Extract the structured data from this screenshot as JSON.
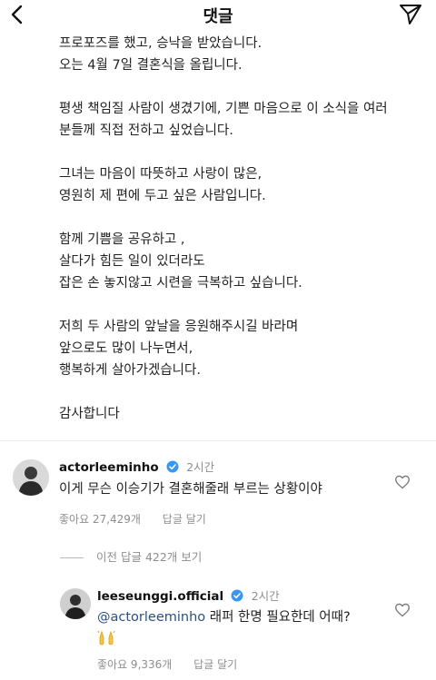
{
  "header": {
    "title": "댓글"
  },
  "post": {
    "lines": [
      "프로포즈를 했고, 승낙을 받았습니다.",
      "오는 4월 7일 결혼식을 올립니다.",
      "",
      "평생 책임질 사람이 생겼기에, 기쁜 마음으로 이 소식을 여러",
      "분들께 직접 전하고 싶었습니다.",
      "",
      "그녀는 마음이 따뜻하고 사랑이 많은,",
      "영원히 제 편에 두고 싶은 사람입니다.",
      "",
      "함께 기쁨을 공유하고 ,",
      "살다가 힘든 일이 있더라도",
      "잡은 손 놓지않고 시련을 극복하고 싶습니다.",
      "",
      "저희 두 사람의 앞날을 응원해주시길 바라며",
      "앞으로도 많이 나누면서,",
      "행복하게 살아가겠습니다.",
      "",
      "감사합니다"
    ]
  },
  "comments": [
    {
      "username": "actorleeminho",
      "time": "2시간",
      "text": "이게 무슨 이승기가 결혼해줄래 부르는 상황이야",
      "likes": "좋아요 27,429개",
      "reply_label": "답글 달기"
    }
  ],
  "view_previous": "이전 답글 422개 보기",
  "reply": {
    "username": "leeseunggi.official",
    "time": "2시간",
    "mention": "@actorleeminho",
    "text": " 래퍼 한명 필요한데 어때?",
    "emoji": "raising-hands",
    "likes": "좋아요 9,336개",
    "reply_label": "답글 달기"
  },
  "colors": {
    "mention": "#2e4f7e",
    "verified": "#3897f0",
    "muted": "#8e8e8e"
  },
  "icons": [
    "back-arrow-icon",
    "send-icon",
    "verified-badge-icon",
    "heart-icon"
  ]
}
